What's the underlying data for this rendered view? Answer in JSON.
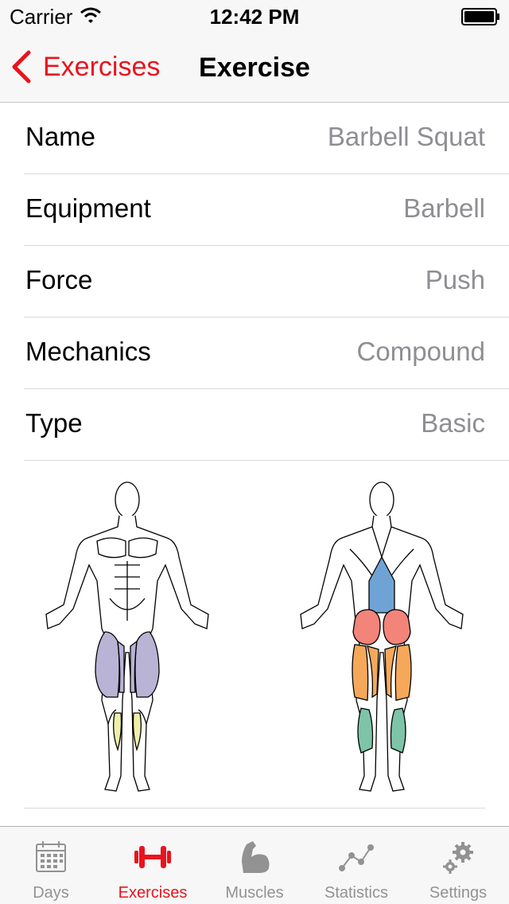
{
  "status_bar": {
    "carrier": "Carrier",
    "time": "12:42 PM"
  },
  "nav": {
    "back_label": "Exercises",
    "title": "Exercise"
  },
  "rows": [
    {
      "label": "Name",
      "value": "Barbell Squat"
    },
    {
      "label": "Equipment",
      "value": "Barbell"
    },
    {
      "label": "Force",
      "value": "Push"
    },
    {
      "label": "Mechanics",
      "value": "Compound"
    },
    {
      "label": "Type",
      "value": "Basic"
    }
  ],
  "muscle_colors": {
    "quadriceps": "#b9b3d6",
    "adductors": "#eef0a8",
    "lower_back": "#6fa3d6",
    "glutes": "#f2847a",
    "hamstrings": "#f5a85a",
    "calves": "#7ec4a8"
  },
  "tabs": [
    {
      "label": "Days",
      "icon": "calendar-icon",
      "active": false
    },
    {
      "label": "Exercises",
      "icon": "dumbbell-icon",
      "active": true
    },
    {
      "label": "Muscles",
      "icon": "bicep-icon",
      "active": false
    },
    {
      "label": "Statistics",
      "icon": "chart-line-icon",
      "active": false
    },
    {
      "label": "Settings",
      "icon": "gears-icon",
      "active": false
    }
  ],
  "accent_color": "#e8141e"
}
